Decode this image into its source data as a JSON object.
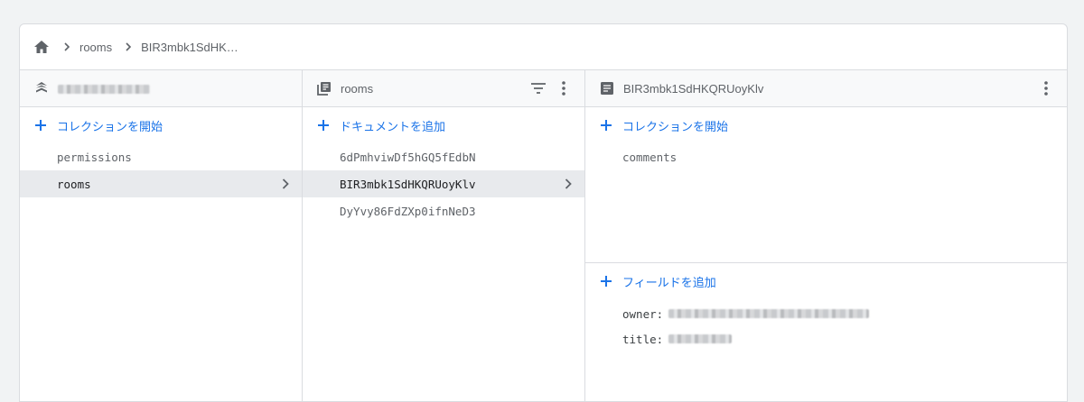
{
  "breadcrumb": {
    "items": [
      "rooms",
      "BIR3mbk1SdHK…"
    ]
  },
  "panel_root": {
    "project_name": "",
    "add_label": "コレクションを開始",
    "items": [
      {
        "label": "permissions",
        "selected": false
      },
      {
        "label": "rooms",
        "selected": true
      }
    ]
  },
  "panel_collection": {
    "title": "rooms",
    "add_label": "ドキュメントを追加",
    "items": [
      {
        "label": "6dPmhviwDf5hGQ5fEdbN",
        "selected": false
      },
      {
        "label": "BIR3mbk1SdHKQRUoyKlv",
        "selected": true
      },
      {
        "label": "DyYvy86FdZXp0ifnNeD3",
        "selected": false
      }
    ]
  },
  "panel_document": {
    "title": "BIR3mbk1SdHKQRUoyKlv",
    "add_collection_label": "コレクションを開始",
    "subcollections": [
      "comments"
    ],
    "add_field_label": "フィールドを追加",
    "fields": [
      {
        "key": "owner:",
        "value": ""
      },
      {
        "key": "title:",
        "value": ""
      }
    ]
  },
  "colors": {
    "accent": "#1a73e8",
    "selected_bg": "#e8eaed",
    "border": "#dadce0",
    "header_bg": "#f8f9fa"
  }
}
